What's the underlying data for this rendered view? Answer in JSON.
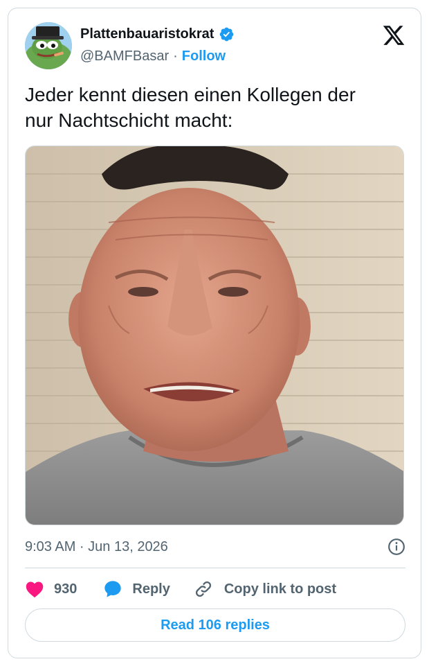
{
  "author": {
    "display_name": "Plattenbauaristokrat",
    "handle": "@BAMFBasar",
    "separator": "·",
    "follow_label": "Follow",
    "verified": true
  },
  "post": {
    "text": "Jeder kennt diesen einen Kollegen der\nnur Nachtschicht macht:",
    "timestamp": "9:03 AM · Jun 13, 2026"
  },
  "engagement": {
    "like_count": "930",
    "reply_label": "Reply",
    "copy_link_label": "Copy link to post",
    "read_replies_label": "Read 106 replies"
  },
  "icons": {
    "brand": "x-logo-icon",
    "verified": "verified-badge-icon",
    "info": "info-icon",
    "like": "heart-icon",
    "reply": "speech-bubble-icon",
    "copy": "link-icon"
  },
  "colors": {
    "accent": "#1d9bf0",
    "like": "#f91880",
    "muted": "#536471",
    "border": "#cfd9de"
  }
}
